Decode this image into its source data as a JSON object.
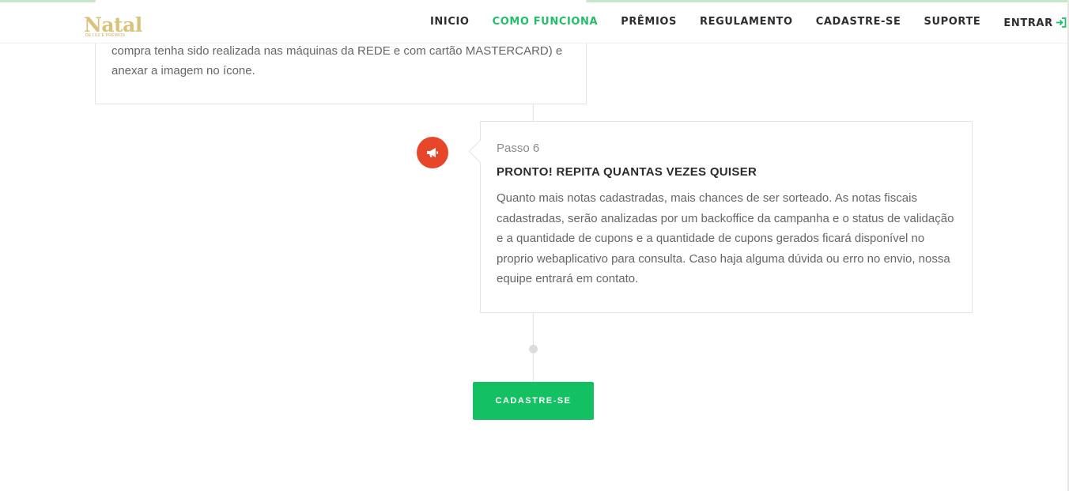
{
  "header": {
    "logo_text": "Natal",
    "logo_subtitle": "DE LUZ E PRÊMIOS",
    "nav": [
      {
        "label": "INICIO"
      },
      {
        "label": "COMO FUNCIONA"
      },
      {
        "label": "PRÊMIOS"
      },
      {
        "label": "REGULAMENTO"
      },
      {
        "label": "CADASTRE-SE"
      },
      {
        "label": "SUPORTE"
      },
      {
        "label": "ENTRAR"
      }
    ],
    "active_nav": "COMO FUNCIONA",
    "accent_color": "#1fbf66"
  },
  "step5": {
    "text": "compra tenha sido realizada nas máquinas da REDE e com cartão MASTERCARD) e anexar a imagem no ícone."
  },
  "step6": {
    "step_label": "Passo 6",
    "title": "PRONTO! REPITA QUANTAS VEZES QUISER",
    "text": "Quanto mais notas cadastradas, mais chances de ser sorteado. As notas fiscais cadastradas, serão analizadas por um backoffice da campanha e o status de validação e a quantidade de cupons e a quantidade de cupons gerados ficará disponível no proprio webaplicativo para consulta. Caso haja alguma dúvida ou erro no envio, nossa equipe entrará em contato.",
    "icon": "megaphone-icon",
    "icon_color": "#e8462b"
  },
  "cta": {
    "label": "CADASTRE-SE",
    "color": "#14c162"
  }
}
